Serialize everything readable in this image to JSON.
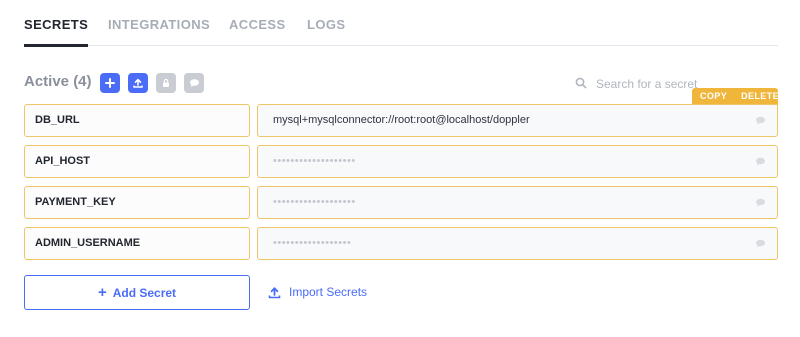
{
  "tabs": [
    {
      "label": "SECRETS",
      "active": true
    },
    {
      "label": "INTEGRATIONS",
      "active": false
    },
    {
      "label": "ACCESS",
      "active": false
    },
    {
      "label": "LOGS",
      "active": false
    }
  ],
  "secrets": {
    "heading": "Active (4)",
    "toolbar": {
      "add_icon": "plus-icon",
      "upload_icon": "upload-icon",
      "lock_icon": "lock-icon",
      "comment_icon": "comment-icon"
    },
    "search": {
      "placeholder": "Search for a secret",
      "value": "",
      "icon": "search-icon"
    },
    "row_actions": {
      "copy_label": "COPY",
      "delete_label": "DELETE"
    },
    "rows": [
      {
        "key": "DB_URL",
        "value": "mysql+mysqlconnector://root:root@localhost/doppler",
        "masked": false
      },
      {
        "key": "API_HOST",
        "value": "•••••••••••••••••••",
        "masked": true
      },
      {
        "key": "PAYMENT_KEY",
        "value": "•••••••••••••••••••",
        "masked": true
      },
      {
        "key": "ADMIN_USERNAME",
        "value": "••••••••••••••••••",
        "masked": true
      }
    ],
    "add_button": {
      "label": "Add Secret",
      "icon": "plus-icon"
    },
    "import_link": {
      "label": "Import Secrets",
      "icon": "upload-icon"
    }
  },
  "colors": {
    "accent": "#4a6cf7",
    "highlight": "#f0b63c",
    "disabled": "#c9ccd2"
  }
}
